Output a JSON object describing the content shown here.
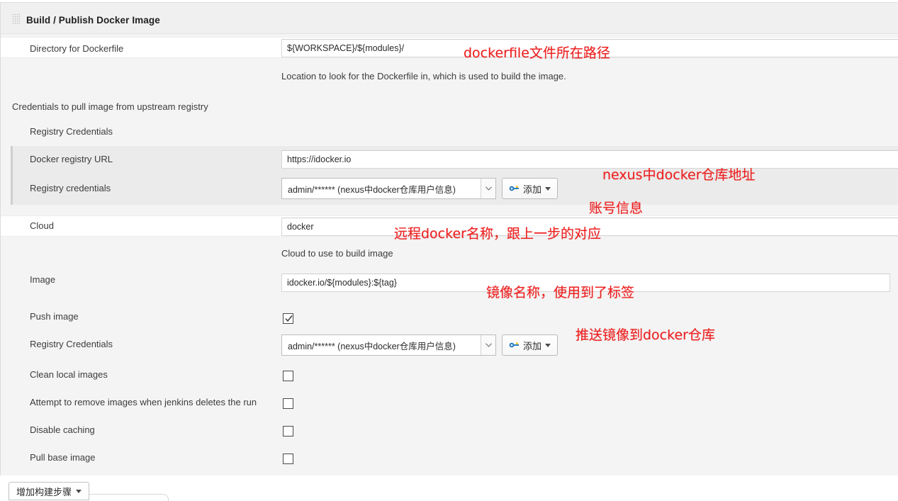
{
  "panel": {
    "title": "Build / Publish Docker Image",
    "grip_icon": "drag-grip-icon"
  },
  "fields": {
    "directory": {
      "label": "Directory for Dockerfile",
      "value": "${WORKSPACE}/${modules}/",
      "help": "Location to look for the Dockerfile in, which is used to build the image."
    },
    "pull_credentials_section": {
      "label": "Credentials to pull image from upstream registry",
      "registry_credentials_label": "Registry Credentials"
    },
    "registry_url": {
      "label": "Docker registry URL",
      "value": "https://idocker.io"
    },
    "registry_credentials": {
      "label": "Registry credentials",
      "selected": "admin/****** (nexus中docker仓库用户信息)",
      "add_button": "添加",
      "add_button_icon": "key-icon",
      "dropdown_icon": "chevron-down-icon",
      "caret_icon": "caret-down-icon"
    },
    "cloud": {
      "label": "Cloud",
      "value": "docker",
      "help": "Cloud to use to build image"
    },
    "image": {
      "label": "Image",
      "value": "idocker.io/${modules}:${tag}"
    },
    "push_image": {
      "label": "Push image",
      "checked": true,
      "check_icon": "checkmark-icon"
    },
    "push_registry_credentials": {
      "label": "Registry Credentials",
      "selected": "admin/****** (nexus中docker仓库用户信息)",
      "add_button": "添加",
      "add_button_icon": "key-icon"
    },
    "clean_local_images": {
      "label": "Clean local images",
      "checked": false
    },
    "attempt_remove_images": {
      "label": "Attempt to remove images when jenkins deletes the run",
      "checked": false
    },
    "disable_caching": {
      "label": "Disable caching",
      "checked": false
    },
    "pull_base_image": {
      "label": "Pull base image",
      "checked": false
    }
  },
  "footer": {
    "add_build_step": "增加构建步骤",
    "caret_icon": "caret-down-icon"
  },
  "annotations": [
    {
      "text": "dockerfile文件所在路径"
    },
    {
      "text": "nexus中docker仓库地址"
    },
    {
      "text": "账号信息"
    },
    {
      "text": "远程docker名称，跟上一步的对应"
    },
    {
      "text": "镜像名称，使用到了标签"
    },
    {
      "text": "推送镜像到docker仓库"
    }
  ],
  "colors": {
    "annotation": "#ec2020",
    "panel_bg": "#f4f4f4",
    "header_bg": "#f0f0f0",
    "credential_block_bg": "#ebebeb"
  }
}
